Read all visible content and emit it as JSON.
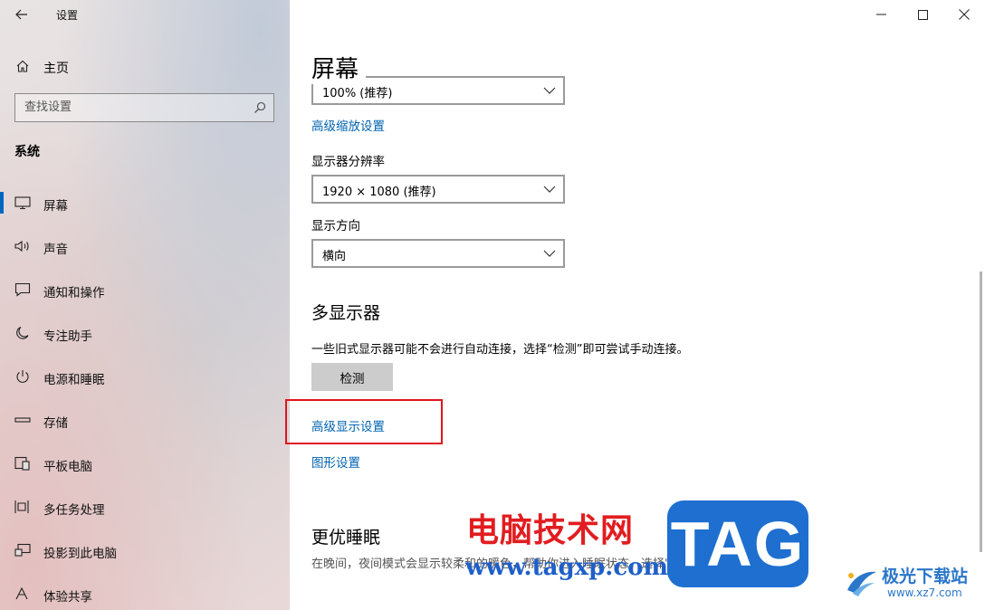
{
  "window": {
    "title": "设置"
  },
  "sidebar": {
    "home_label": "主页",
    "search_placeholder": "查找设置",
    "section_title": "系统",
    "items": [
      {
        "label": "屏幕",
        "icon": "monitor-icon",
        "active": true
      },
      {
        "label": "声音",
        "icon": "speaker-icon"
      },
      {
        "label": "通知和操作",
        "icon": "message-icon"
      },
      {
        "label": "专注助手",
        "icon": "moon-icon"
      },
      {
        "label": "电源和睡眠",
        "icon": "power-icon"
      },
      {
        "label": "存储",
        "icon": "storage-icon"
      },
      {
        "label": "平板电脑",
        "icon": "tablet-icon"
      },
      {
        "label": "多任务处理",
        "icon": "multitask-icon"
      },
      {
        "label": "投影到此电脑",
        "icon": "project-icon"
      },
      {
        "label": "体验共享",
        "icon": "share-icon"
      }
    ]
  },
  "content": {
    "page_title": "屏幕",
    "scale_value": "100% (推荐)",
    "advanced_scaling_link": "高级缩放设置",
    "resolution_label": "显示器分辨率",
    "resolution_value": "1920 × 1080 (推荐)",
    "orientation_label": "显示方向",
    "orientation_value": "横向",
    "multi_display_heading": "多显示器",
    "multi_display_desc": "一些旧式显示器可能不会进行自动连接，选择“检测”即可尝试手动连接。",
    "detect_button": "检测",
    "advanced_display_link": "高级显示设置",
    "graphics_link": "图形设置",
    "sleep_heading": "更优睡眠",
    "sleep_desc": "在晚间，夜间模式会显示较柔和的暖色，帮助你进入睡眠状态。选择\"夜间模式设置\"进行设置。"
  },
  "watermark": {
    "site_cn": "电脑技术网",
    "site_url": "www.tagxp.com",
    "tag_logo": "TAG",
    "jg_title": "极光下载站",
    "jg_url": "www.xz7.com"
  },
  "colors": {
    "accent": "#0067c0",
    "link": "#0063b1",
    "highlight": "#e0151d"
  }
}
